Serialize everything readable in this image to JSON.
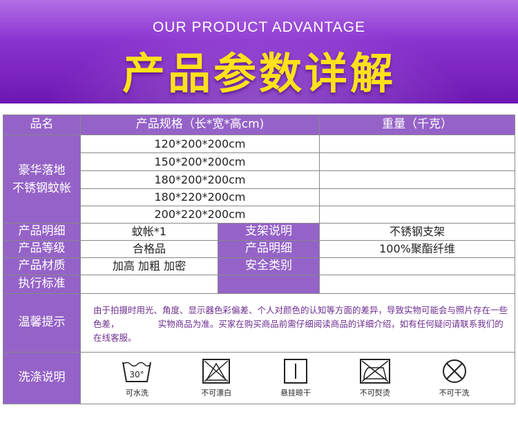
{
  "banner": {
    "subtitle": "OUR PRODUCT ADVANTAGE",
    "title": "产品参数详解"
  },
  "table": {
    "headers": {
      "name": "品名",
      "spec": "产品规格（长*宽*高cm)",
      "weight": "重量（千克）"
    },
    "product_name": "豪华落地\n不锈钢蚊帐",
    "sizes": [
      "120*200*200cm",
      "150*200*200cm",
      "180*200*200cm",
      "180*220*200cm",
      "200*220*200cm"
    ],
    "weights": [
      "",
      "",
      "",
      "",
      ""
    ],
    "rows": [
      {
        "label1": "产品明细",
        "value1": "蚊帐*1",
        "label2": "支架说明",
        "value2": "不锈钢支架"
      },
      {
        "label1": "产品等级",
        "value1": "合格品",
        "label2": "产品明细",
        "value2": "100%聚酯纤维"
      },
      {
        "label1": "产品材质",
        "value1": "加高 加粗 加密",
        "label2": "安全类别",
        "value2": ""
      },
      {
        "label1": "执行标准",
        "value1": "",
        "label2": "",
        "value2": ""
      }
    ],
    "tips_label": "温馨提示",
    "tips_text": "由于拍摄时用光、角度、显示器色彩偏差、个人对颜色的认知等方面的差异，导致实物可能会与照片存在一些色差，　　　　　实物商品为准。买家在购买商品前需仔细阅读商品的详细介绍，如有任何疑问请联系我们的在线客服。",
    "wash_label": "洗涤说明",
    "wash_items": [
      {
        "icon": "wash-30-icon",
        "label": "可水洗",
        "temp": "30°"
      },
      {
        "icon": "no-bleach-icon",
        "label": "不可漂白"
      },
      {
        "icon": "hang-dry-icon",
        "label": "悬挂晾干"
      },
      {
        "icon": "no-iron-icon",
        "label": "不可熨烫"
      },
      {
        "icon": "no-dry-clean-icon",
        "label": "不可干洗"
      }
    ]
  },
  "colors": {
    "banner_top": "#b16ee6",
    "banner_bottom": "#6d16b3",
    "title_yellow": "#ffe11b",
    "label_purple": "#9563c8",
    "note_purple": "#6d2c8f"
  }
}
